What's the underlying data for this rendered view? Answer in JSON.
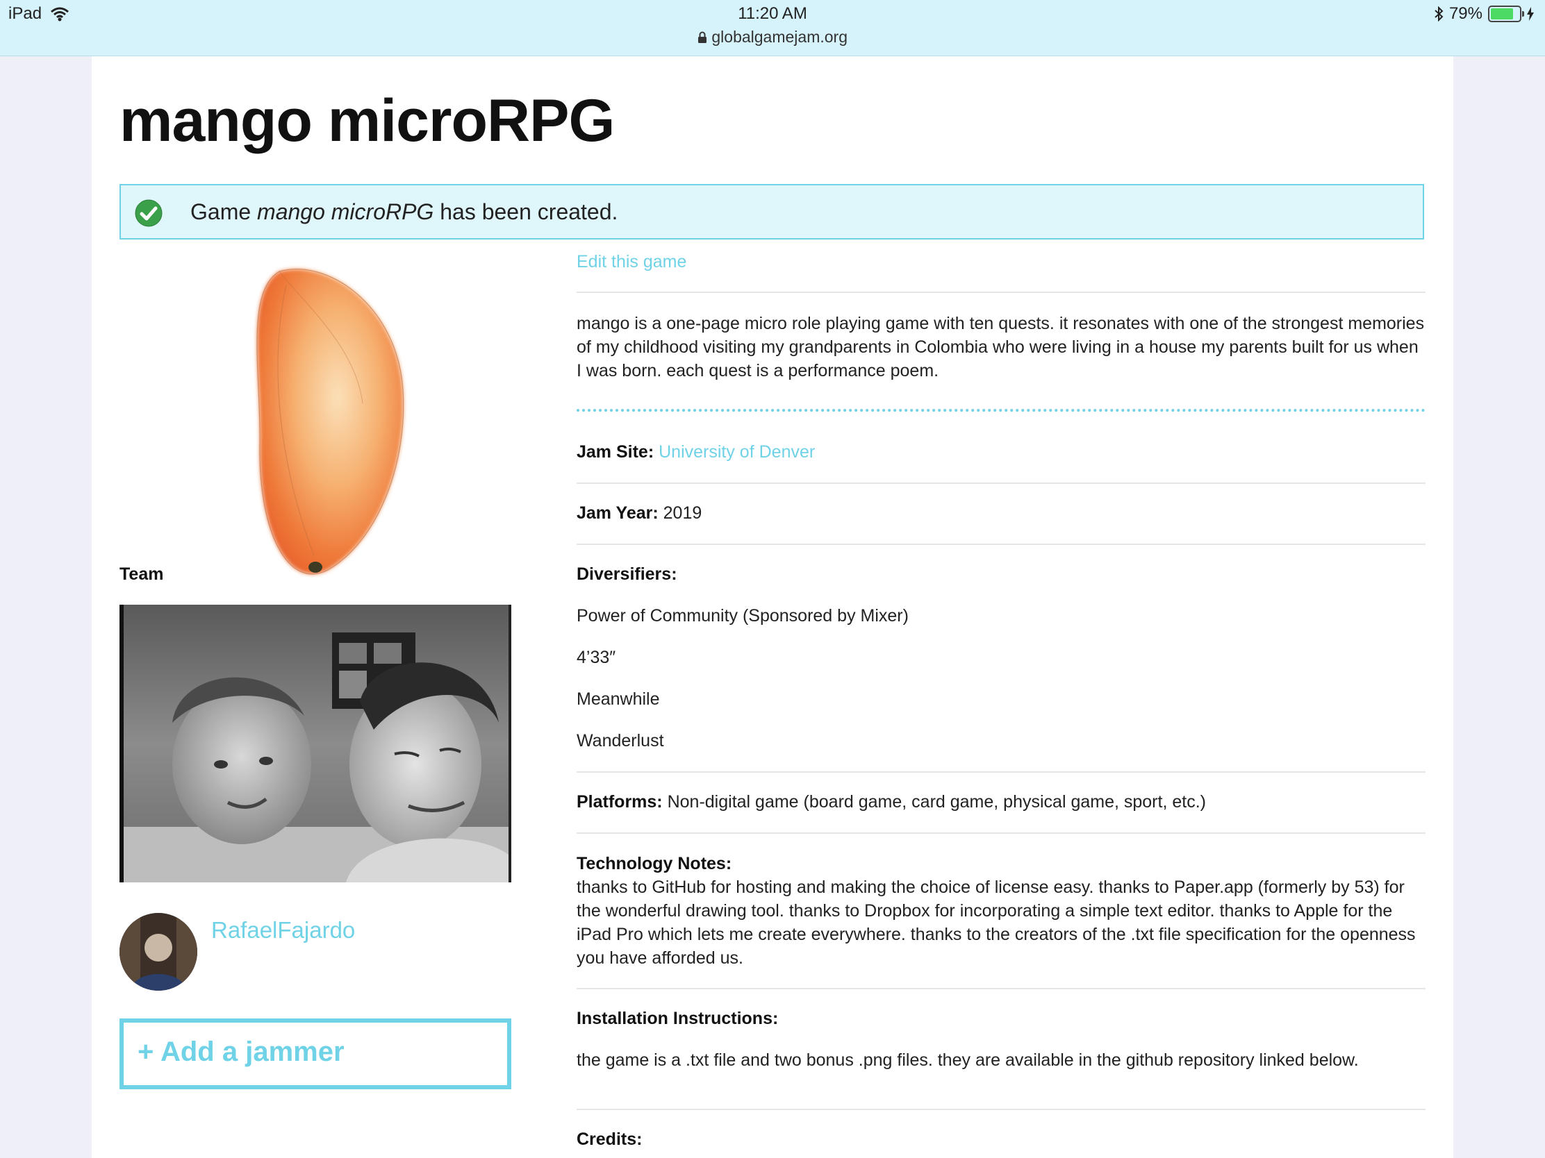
{
  "status_bar": {
    "device": "iPad",
    "time": "11:20 AM",
    "url": "globalgamejam.org",
    "battery": "79%",
    "battery_level": 0.79
  },
  "page": {
    "title": "mango microRPG",
    "notice": {
      "prefix": "Game ",
      "game": "mango microRPG",
      "suffix": " has been created."
    },
    "edit_link": "Edit this game",
    "description": "mango is a one-page micro role playing game with ten quests. it resonates with one of the strongest memories of my childhood visiting my grandparents in Colombia who were living in a house my parents built for us when I was born. each quest is a performance poem.",
    "jam_site": {
      "label": "Jam Site:",
      "value": "University of Denver"
    },
    "jam_year": {
      "label": "Jam Year:",
      "value": "2019"
    },
    "diversifiers": {
      "label": "Diversifiers:",
      "items": [
        "Power of Community (Sponsored by Mixer)",
        "4’33″",
        "Meanwhile",
        "Wanderlust"
      ]
    },
    "platforms": {
      "label": "Platforms:",
      "value": "Non-digital game (board game, card game, physical game, sport, etc.)"
    },
    "technology_notes": {
      "label": "Technology Notes:",
      "value": "thanks to GitHub for hosting and making the choice of license easy. thanks to Paper.app (formerly by 53) for the wonderful drawing tool. thanks to Dropbox for incorporating a simple text editor. thanks to Apple for the iPad Pro which lets me create everywhere. thanks to the creators of the .txt file specification for the openness you have afforded us."
    },
    "installation": {
      "label": "Installation Instructions:",
      "value": "the game is a .txt file and two bonus .png files. they are available in the github repository linked below."
    },
    "credits": {
      "label": "Credits:"
    },
    "team": {
      "heading": "Team",
      "members": [
        {
          "name": "RafaelFajardo"
        }
      ],
      "add_button": "+ Add a jammer"
    }
  },
  "colors": {
    "accent": "#6fd2e6",
    "notice_bg": "#dff6fb",
    "status_bar_bg": "#d6f2fa"
  }
}
